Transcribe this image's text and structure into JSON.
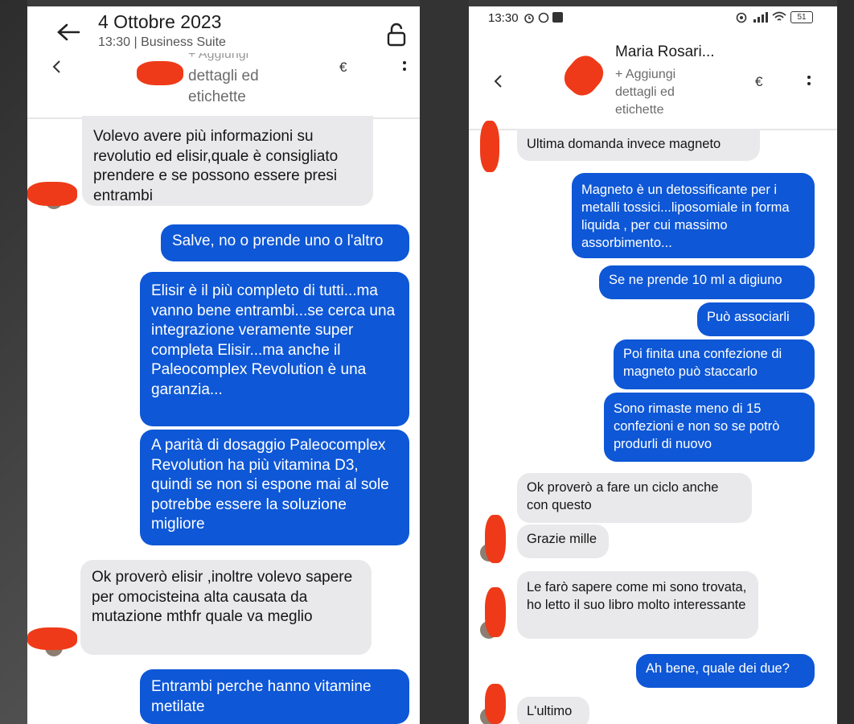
{
  "left_screen": {
    "date_title": "4 Ottobre 2023",
    "subtitle": "13:30 | Business Suite",
    "contact_hint": "dettagli ed",
    "contact_hint2": "etichette",
    "contact_hint_partial": "+ Aggiungi",
    "currency": "€",
    "messages": [
      {
        "dir": "in",
        "text": "Volevo avere più informazioni su revolutio ed elisir,quale è consigliato prendere e se possono essere  presi entrambi"
      },
      {
        "dir": "out",
        "text": "Salve, no o prende uno o l'altro"
      },
      {
        "dir": "out",
        "text": "Elisir è il più completo di tutti...ma vanno bene entrambi...se cerca una integrazione veramente super completa Elisir...ma anche il Paleocomplex Revolution è una garanzia..."
      },
      {
        "dir": "out",
        "text": "A parità di dosaggio Paleocomplex Revolution ha più vitamina D3, quindi se non si espone mai al sole potrebbe essere la soluzione migliore"
      },
      {
        "dir": "in",
        "text": "Ok proverò elisir ,inoltre volevo sapere per omocisteina alta causata da mutazione mthfr quale va meglio"
      },
      {
        "dir": "out",
        "text": "Entrambi perche hanno vitamine metilate"
      }
    ]
  },
  "right_screen": {
    "status_time": "13:30",
    "battery": "51",
    "contact_name": "Maria Rosari...",
    "add_details": "+ Aggiungi",
    "add_details2": "dettagli ed",
    "add_details3": "etichette",
    "currency": "€",
    "messages": [
      {
        "dir": "in",
        "text": "Ultima domanda invece magneto"
      },
      {
        "dir": "out",
        "text": "Magneto è un detossificante per i metalli tossici...liposomiale in forma liquida , per cui massimo assorbimento..."
      },
      {
        "dir": "out",
        "text": "Se ne prende 10 ml a digiuno"
      },
      {
        "dir": "out",
        "text": "Può associarli"
      },
      {
        "dir": "out",
        "text": "Poi finita una confezione di magneto può staccarlo"
      },
      {
        "dir": "out",
        "text": "Sono rimaste meno di 15 confezioni e non so se potrò produrli di nuovo"
      },
      {
        "dir": "in",
        "text": "Ok proverò a fare un ciclo anche con questo"
      },
      {
        "dir": "in",
        "text": "Grazie mille"
      },
      {
        "dir": "in",
        "text": "Le farò sapere come mi sono trovata, ho letto il suo libro molto interessante"
      },
      {
        "dir": "out",
        "text": "Ah bene, quale dei due?"
      },
      {
        "dir": "in",
        "text": "L'ultimo"
      }
    ]
  },
  "colors": {
    "outgoing": "#0e57d6",
    "incoming": "#e9e9eb",
    "redaction": "#ee3a18",
    "background": "#3a3a3a"
  }
}
